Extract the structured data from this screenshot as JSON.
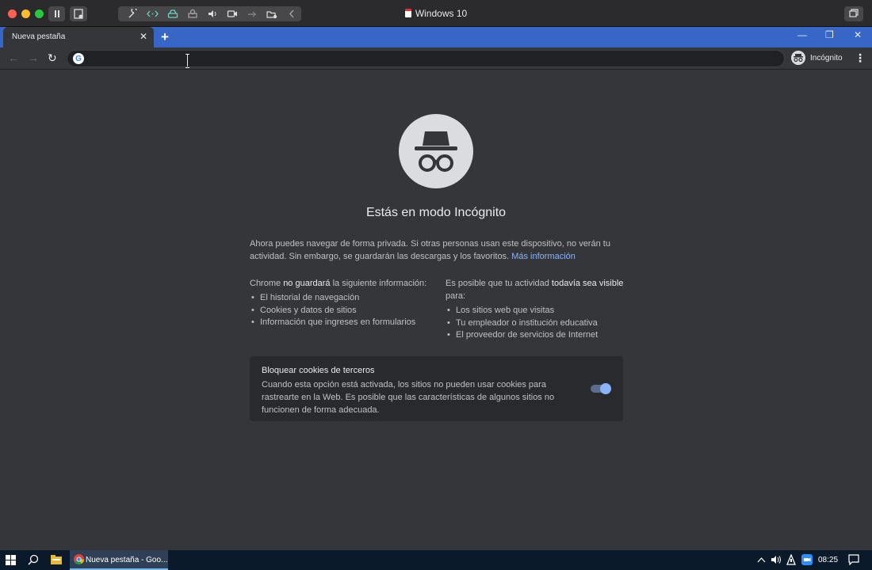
{
  "vm": {
    "title": "Windows 10"
  },
  "browser": {
    "tab": {
      "title": "Nueva pestaña",
      "close": "✕"
    },
    "new_tab": "+",
    "window": {
      "minimize": "—",
      "restore": "❐",
      "close": "✕"
    },
    "nav": {
      "back": "←",
      "forward": "→",
      "reload": "↻"
    },
    "omnibox": {
      "value": "",
      "favicon": "G"
    },
    "profile": {
      "label": "Incógnito"
    },
    "menu": "⋮"
  },
  "page": {
    "title": "Estás en modo Incógnito",
    "intro": "Ahora puedes navegar de forma privada. Si otras personas usan este dispositivo, no verán tu actividad. Sin embargo, se guardarán las descargas y los favoritos.",
    "more_info": "Más información",
    "not_saved": {
      "lead_before": "Chrome ",
      "lead_bold": "no guardará",
      "lead_after": " la siguiente información:",
      "items": [
        "El historial de navegación",
        "Cookies y datos de sitios",
        "Información que ingreses en formularios"
      ]
    },
    "visible": {
      "lead_before": "Es posible que tu actividad ",
      "lead_bold": "todavía sea visible",
      "lead_after": " para:",
      "items": [
        "Los sitios web que visitas",
        "Tu empleador o institución educativa",
        "El proveedor de servicios de Internet"
      ]
    },
    "cookies": {
      "title": "Bloquear cookies de terceros",
      "description": "Cuando esta opción está activada, los sitios no pueden usar cookies para rastrearte en la Web. Es posible que las características de algunos sitios no funcionen de forma adecuada.",
      "enabled": true
    }
  },
  "taskbar": {
    "app_label": "Nueva pestaña - Goo...",
    "clock": "08:25"
  },
  "colors": {
    "accent": "#3667c6",
    "link": "#8ab4f8",
    "background": "#35363a"
  },
  "icons": [
    "incognito-icon",
    "google-icon",
    "windows-start-icon",
    "search-icon",
    "file-explorer-icon",
    "chrome-icon",
    "volume-icon",
    "notification-icon"
  ]
}
